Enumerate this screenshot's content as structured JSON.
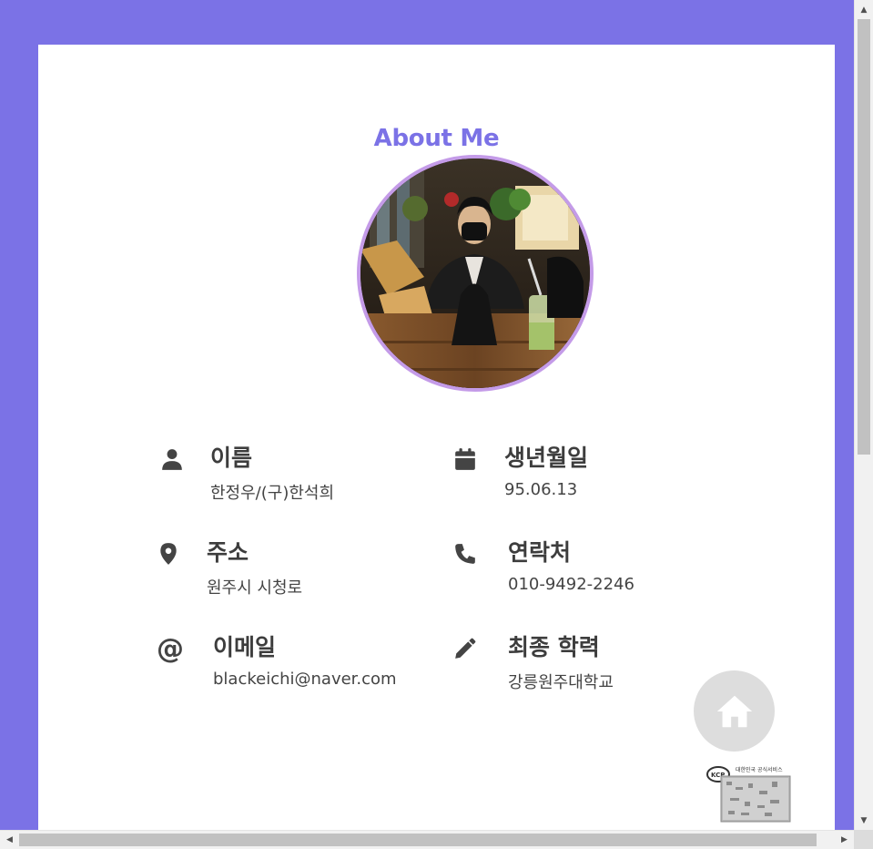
{
  "page": {
    "title": "About Me"
  },
  "profile": {
    "avatar_alt": "profile photo"
  },
  "info": {
    "name": {
      "label": "이름",
      "value": "한정우/(구)한석희",
      "icon": "user-icon"
    },
    "birth": {
      "label": "생년월일",
      "value": "95.06.13",
      "icon": "calendar-icon"
    },
    "address": {
      "label": "주소",
      "value": "원주시 시청로",
      "icon": "map-marker-icon"
    },
    "contact": {
      "label": "연락처",
      "value": "010-9492-2246",
      "icon": "phone-icon"
    },
    "email": {
      "label": "이메일",
      "value": "blackeichi@naver.com",
      "icon": "at-icon"
    },
    "education": {
      "label": "최종 학력",
      "value": "강릉원주대학교",
      "icon": "pencil-icon"
    }
  },
  "home_button": {
    "icon": "home-icon"
  },
  "badge": {
    "icon": "kcp-badge-icon",
    "text": "대한민국 공식서비스"
  },
  "colors": {
    "background": "#7b72e6",
    "accent": "#7b72e6",
    "avatar_border": "#c49be8",
    "text": "#3d3d3d",
    "home_button_bg": "#dddddd"
  }
}
